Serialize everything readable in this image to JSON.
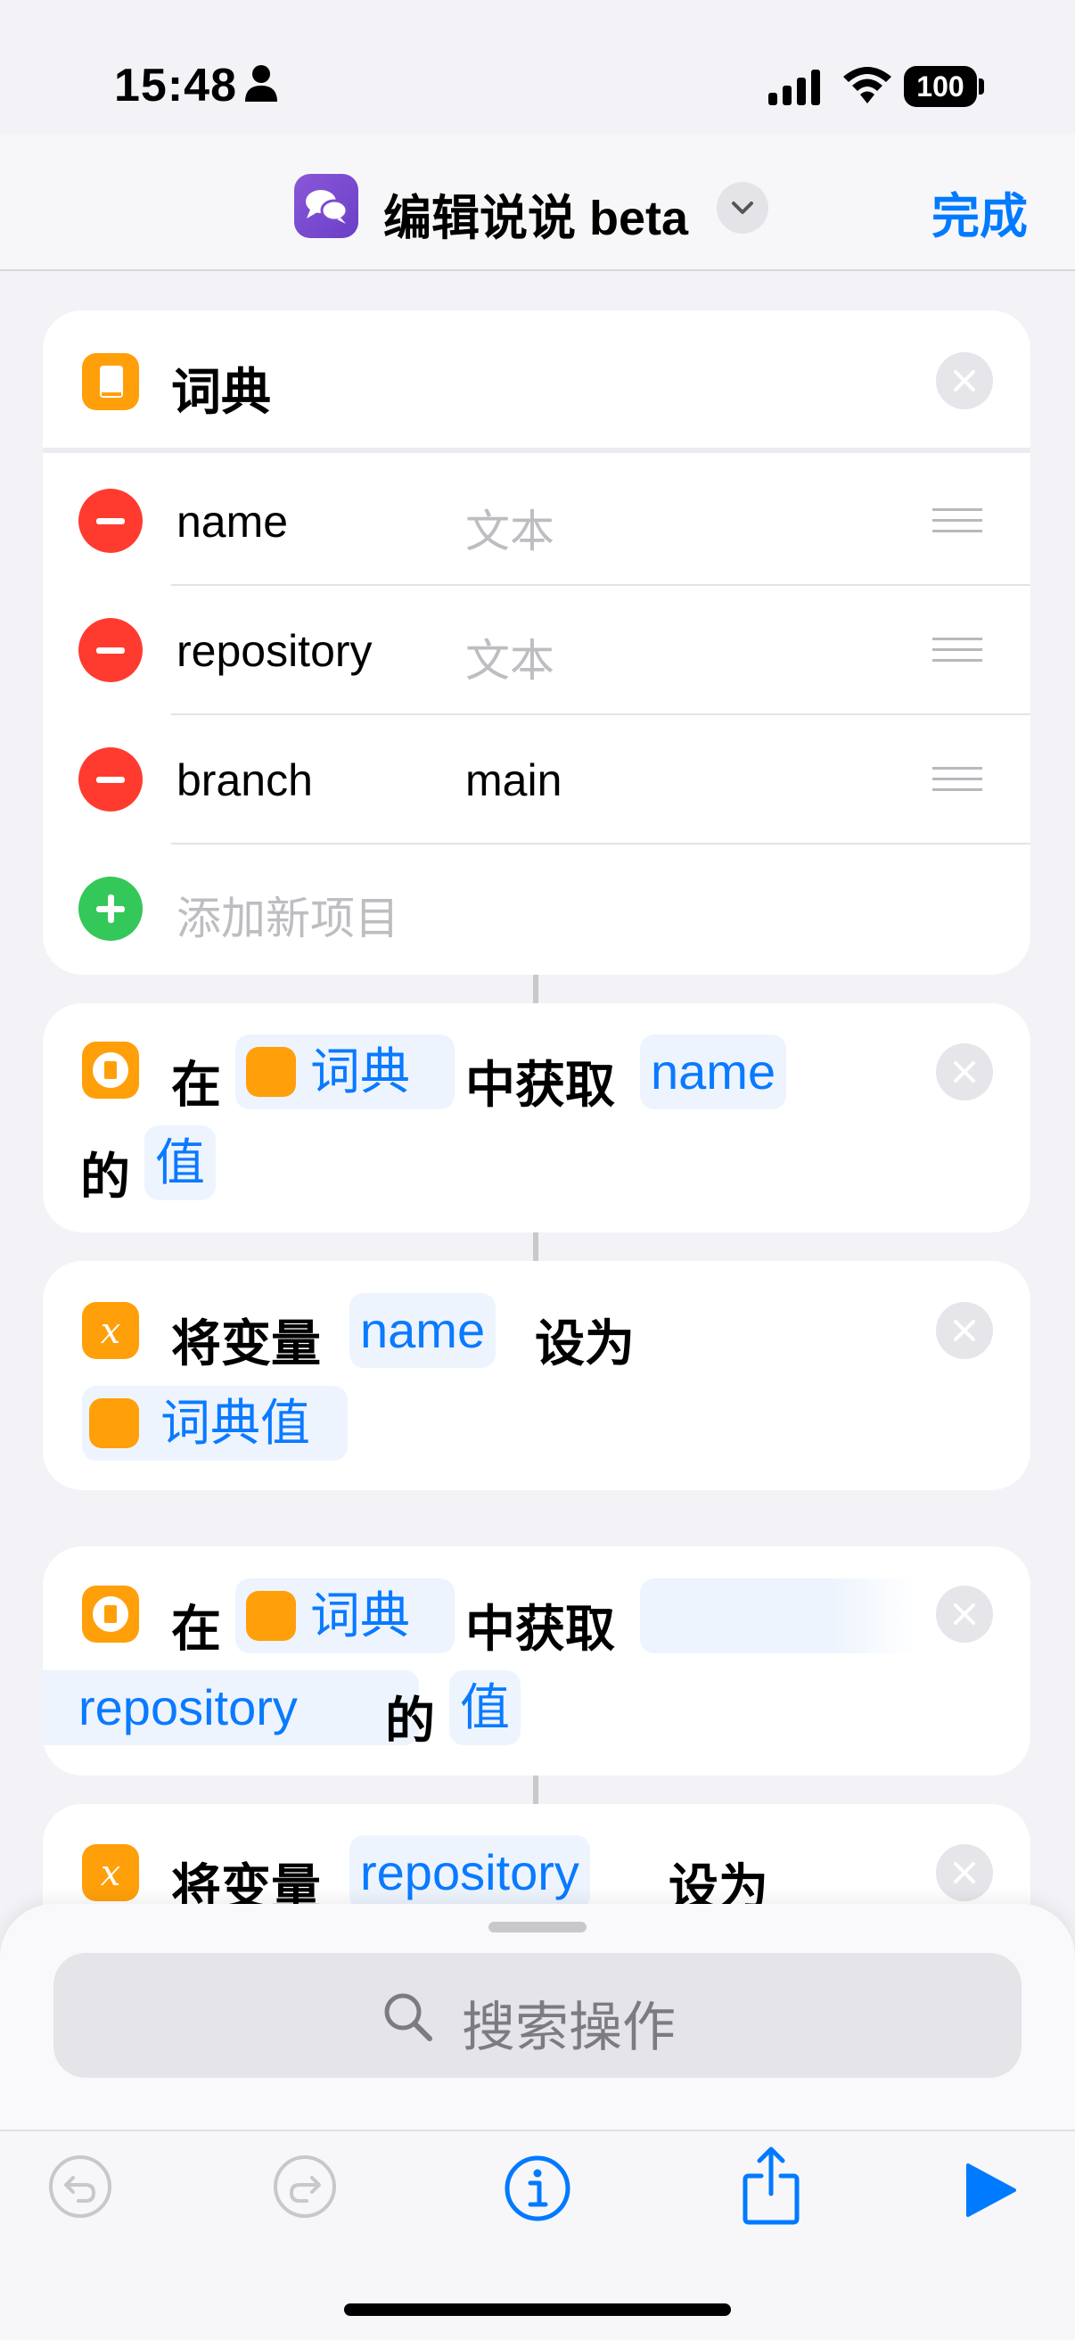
{
  "status_bar": {
    "time": "15:48",
    "battery": "100"
  },
  "nav": {
    "title": "编辑说说 beta",
    "done_label": "完成"
  },
  "dict_card": {
    "title": "词典",
    "rows": [
      {
        "key": "name",
        "value": "文本",
        "placeholder": true
      },
      {
        "key": "repository",
        "value": "文本",
        "placeholder": true
      },
      {
        "key": "branch",
        "value": "main",
        "placeholder": false
      }
    ],
    "add_label": "添加新项目"
  },
  "action1": {
    "prefix": "在",
    "dict_token": "词典",
    "middle": "中获取",
    "key_token": "name",
    "suffix": "的",
    "value_token": "值"
  },
  "action2": {
    "prefix": "将变量",
    "var_token": "name",
    "middle": "设为",
    "value_token": "词典值"
  },
  "action3": {
    "prefix": "在",
    "dict_token": "词典",
    "middle": "中获取",
    "key_token": "repository",
    "suffix": "的",
    "value_token": "值"
  },
  "action4": {
    "prefix": "将变量",
    "var_token": "repository",
    "middle": "设为"
  },
  "search": {
    "placeholder": "搜索操作"
  }
}
